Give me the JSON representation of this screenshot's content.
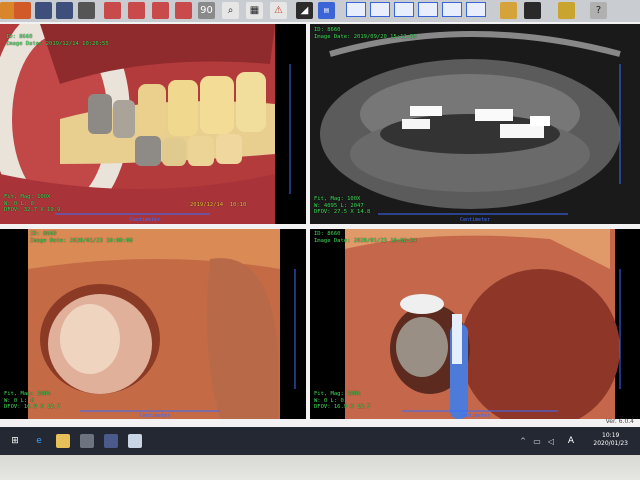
{
  "toolbar": {
    "icons": [
      "search-icon",
      "grid-icon",
      "warning-icon",
      "contrast-icon",
      "export-icon",
      "layout-1-icon",
      "layout-2-icon",
      "layout-4-icon",
      "layout-6-icon",
      "layout-9-icon"
    ],
    "colors": {
      "accent": "#3b64d6",
      "overlay": "#3ddc57"
    }
  },
  "panels": {
    "p1": {
      "line1": "ID: 8660",
      "line2": "Image Date: 2019/12/14 10:26:55",
      "footer": "Fit, Mag: 100X\nW: 0 L: 0\nDFOV: 32.7 X 19.9",
      "stamp": "2019/12/14  10:10",
      "ruler": "Centimeter"
    },
    "p2": {
      "line1": "ID: 8660",
      "line2": "Image Date: 2019/09/20 15:11:55",
      "footer": "Fit, Mag: 100X\nW: 4095 L: 2047\nDFOV: 27.5 X 14.8",
      "ruler": "Centimeter"
    },
    "p3": {
      "line1": "ID: 8660",
      "line2": "Image Date: 2020/01/23 10:00:08",
      "footer": "Fit, Mag: 100%\nW: 0 L: 0\nDFOV: 16.9 X 12.7",
      "ruler": "Centimeter"
    },
    "p4": {
      "line1": "ID: 8660",
      "line2": "Image Date: 2020/01/23 10:02:24",
      "footer": "Fit, Mag: 100%\nW: 0 L: 0\nDFOV: 16.9 X 12.7",
      "ruler": "Centimeter"
    }
  },
  "status": {
    "version": "Ver. 6.0.4"
  },
  "taskbar": {
    "time": "10:19",
    "date": "2020/01/23",
    "ime": "A"
  }
}
